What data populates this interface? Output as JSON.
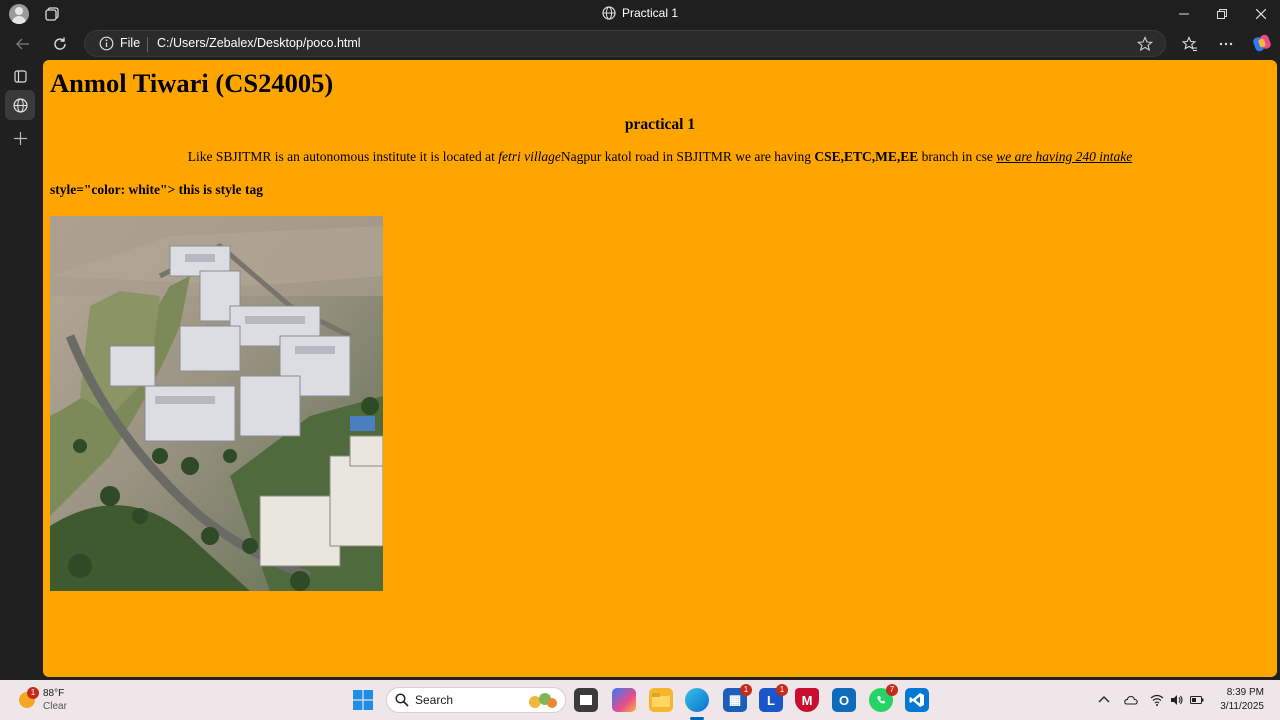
{
  "window": {
    "title": "Practical 1"
  },
  "address_bar": {
    "scheme_label": "File",
    "url": "C:/Users/Zebalex/Desktop/poco.html"
  },
  "page": {
    "heading": "Anmol Tiwari (CS24005)",
    "subheading": "practical 1",
    "paragraph": {
      "text1": "Like SBJITMR is an autonomous institute it is located at ",
      "italic": "fetri village",
      "text2": "Nagpur katol road in SBJITMR we are having ",
      "bold": "CSE,ETC,ME,EE",
      "text3": " branch in cse ",
      "underline_italic": "we are having 240 intake"
    },
    "style_text": "style=\"color: white\"> this is style tag",
    "image_alt": "aerial view of college campus"
  },
  "taskbar": {
    "weather_temp": "88°F",
    "weather_cond": "Clear",
    "weather_badge": "1",
    "search_label": "Search",
    "store_badge": "1",
    "l_badge": "1",
    "whatsapp_badge": "7",
    "time": "8:39 PM",
    "date": "3/11/2025"
  },
  "colors": {
    "page_background": "#ffa500",
    "browser_chrome": "#202020",
    "taskbar": "#efe6e9"
  }
}
